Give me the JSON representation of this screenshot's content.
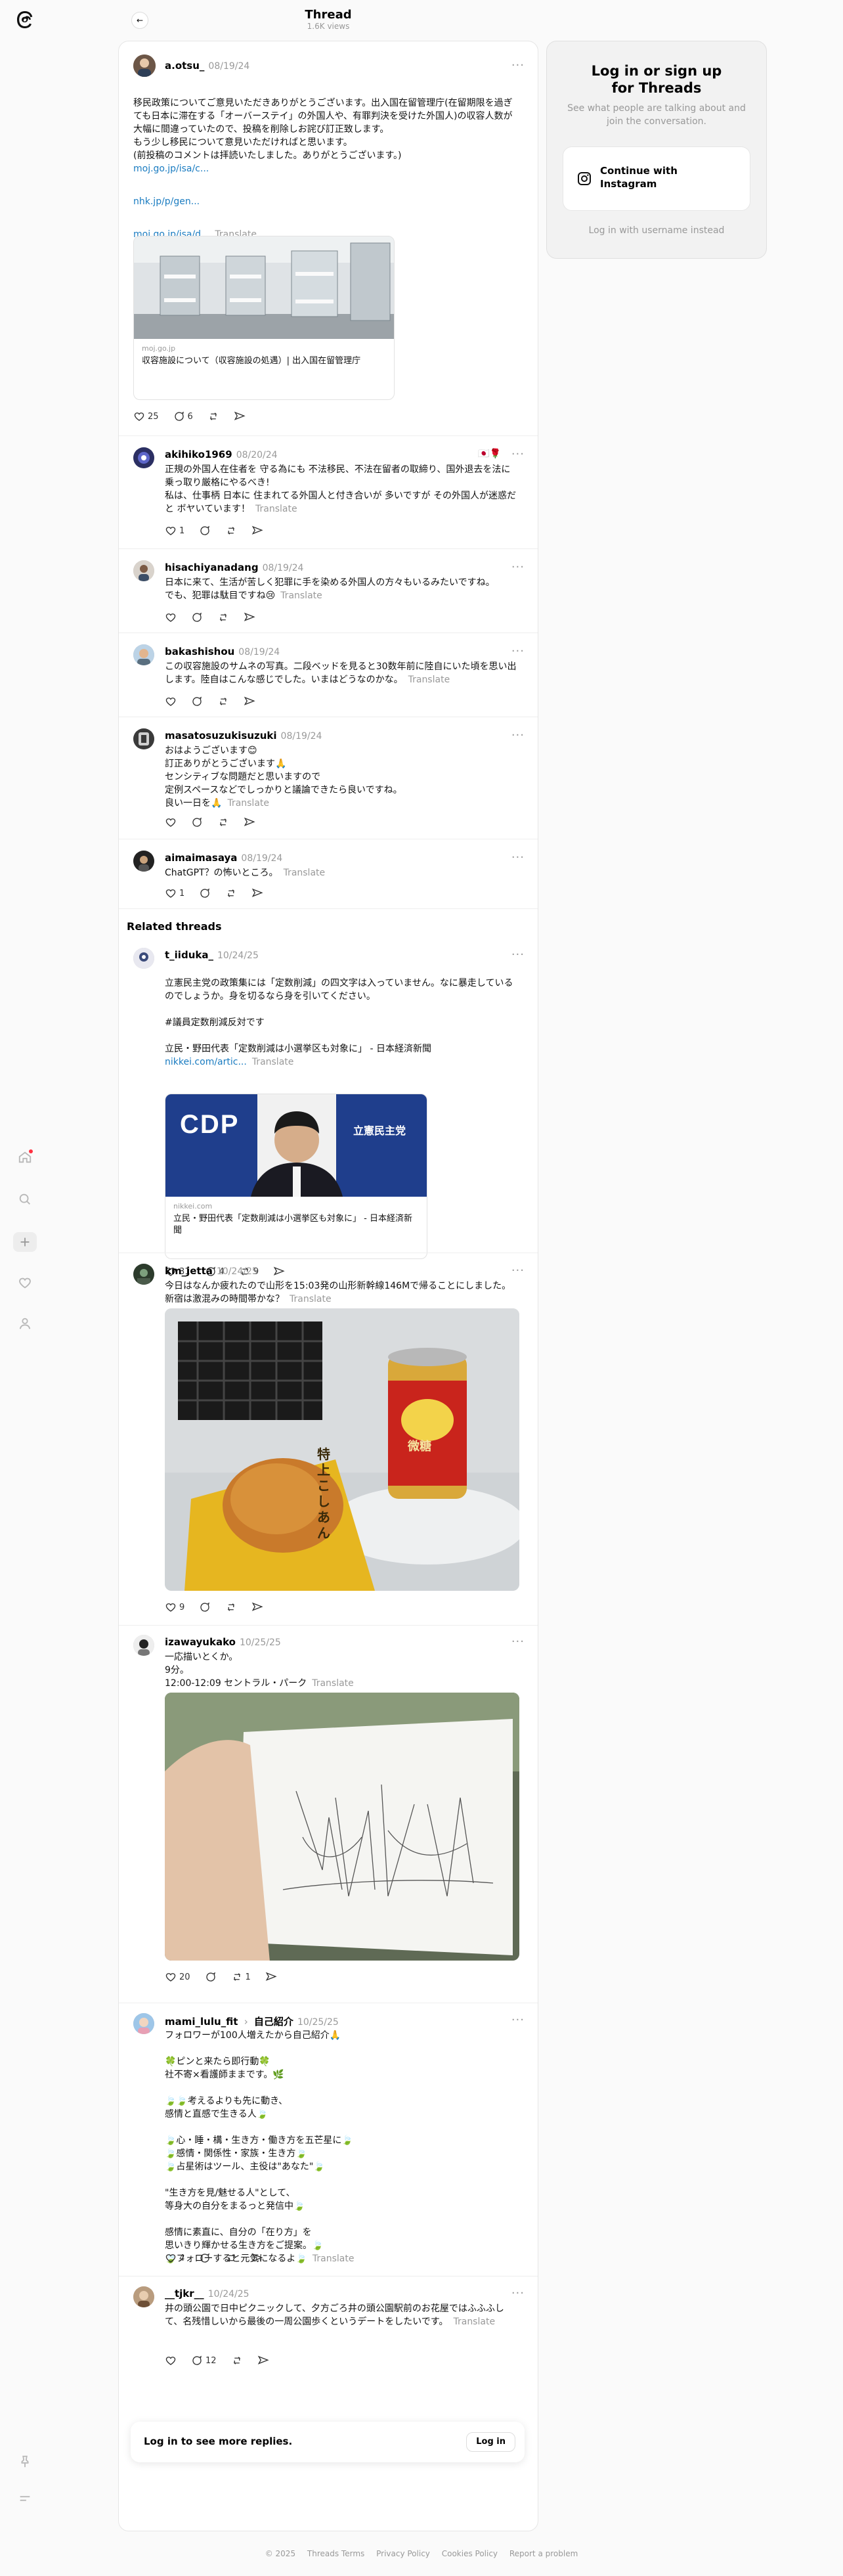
{
  "header": {
    "title": "Thread",
    "views": "1.6K views"
  },
  "sidebar": {
    "title": "Log in or sign up for Threads",
    "subtitle": "See what people are talking about and join the conversation.",
    "instagram_button": "Continue with Instagram",
    "alt_login": "Log in with username instead"
  },
  "translate": "Translate",
  "more": "···",
  "main_post": {
    "username": "a.otsu_",
    "date": "08/19/24",
    "text": "移民政策についてご意見いただきありがとうございます。出入国在留管理庁(在留期限を過ぎても日本に滞在する「オーバーステイ」の外国人や、有罪判決を受けた外国人)の収容人数が大幅に間違っていたので、投稿を削除しお詫び訂正致します。\nもう少し移民について意見いただければと思います。\n(前投稿のコメントは拝読いたしました。ありがとうございます。)",
    "links": [
      "moj.go.jp/isa/c...",
      "nhk.jp/p/gen...",
      "moj.go.jp/isa/d..."
    ],
    "card_domain": "moj.go.jp",
    "card_title": "収容施設について（収容施設の処遇）| 出入国在留管理庁",
    "likes": "25",
    "replies": "6"
  },
  "replies": [
    {
      "username": "akihiko1969",
      "date": "08/20/24",
      "text": "正規の外国人在住者を 守る為にも 不法移民、不法在留者の取締り、国外退去を法に乗っ取り厳格にやるべき!\n私は、仕事柄 日本に 住まれてる外国人と付き合いが 多いですが その外国人が迷惑だと ボヤいています！",
      "likes": "1",
      "replies": ""
    },
    {
      "username": "hisachiyanadang",
      "date": "08/19/24",
      "text": "日本に来て、生活が苦しく犯罪に手を染める外国人の方々もいるみたいですね。\nでも、犯罪は駄目ですね😢",
      "likes": "",
      "replies": ""
    },
    {
      "username": "bakashishou",
      "date": "08/19/24",
      "text": "この収容施設のサムネの写真。二段ベッドを見ると30数年前に陸自にいた頃を思い出します。陸自はこんな感じでした。いまはどうなのかな。",
      "likes": "",
      "replies": ""
    },
    {
      "username": "masatosuzukisuzuki",
      "date": "08/19/24",
      "text": "おはようございます😊\n訂正ありがとうございます🙏\nセンシティブな問題だと思いますので\n定例スペースなどでしっかりと議論できたら良いですね。\n良い一日を🙏",
      "likes": "",
      "replies": ""
    },
    {
      "username": "aimaimasaya",
      "date": "08/19/24",
      "text": "ChatGPT？の怖いところ。",
      "likes": "1",
      "replies": ""
    }
  ],
  "related_title": "Related threads",
  "related": [
    {
      "username": "t_iiduka_",
      "date": "10/24/25",
      "text": "立憲民主党の政策集には「定数削減」の四文字は入っていません。なに暴走しているのでしょうか。身を切るなら身を引いてください。\n\n#議員定数削減反対です\n\n立民・野田代表「定数削減は小選挙区も対象に」 - 日本経済新聞",
      "link": "nikkei.com/artic...",
      "card_domain": "nikkei.com",
      "card_title": "立民・野田代表「定数削減は小選挙区も対象に」 - 日本経済新聞",
      "logo_text": "CDP",
      "banner_text": "立憲民主党",
      "likes": "31",
      "replies": "4",
      "reposts": "9"
    },
    {
      "username": "km_jetta",
      "date": "10/24/25",
      "text": "今日はなんか疲れたので山形を15:03発の山形新幹線146Mで帰ることにしました。新宿は激混みの時間帯かな？",
      "image_labels": [
        "特上 こしあん",
        "微糖"
      ],
      "likes": "9",
      "replies": "",
      "reposts": ""
    },
    {
      "username": "izawayukako",
      "date": "10/25/25",
      "text": "一応描いとくか。\n9分。\n12:00-12:09 セントラル・パーク",
      "likes": "20",
      "replies": "",
      "reposts": "1"
    },
    {
      "username": "mami_lulu_fit",
      "tag": "自己紹介",
      "date": "10/25/25",
      "text": "フォロワーが100人増えたから自己紹介🙏\n\n🍀ピンと来たら即行動🍀\n社不寄×看護師ままです。🌿\n\n🍃🍃考えるよりも先に動き、\n感情と直感で生きる人🍃\n\n🍃心・睡・構・生き方・働き方を五芒星に🍃\n🍃感情・関係性・家族・生き方🍃\n🍃占星術はツール、主役は\"あなた\"🍃\n\n\"生き方を見/魅せる人\"として、\n等身大の自分をまるっと発信中🍃\n\n感情に素直に、自分の「在り方」を\n思いきり輝かせる生き方をご提案。🍃\n🍃フォローすると元気になるよ🍃",
      "likes": "4",
      "replies": "",
      "reposts": ""
    },
    {
      "username": "__tjkr__",
      "date": "10/24/25",
      "text": "井の頭公園で日中ピクニックして、夕方ごろ井の頭公園駅前のお花屋ではふふふして、名残惜しいから最後の一周公園歩くというデートをしたいです。",
      "likes": "",
      "replies": "12",
      "reposts": ""
    }
  ],
  "login_bar": {
    "text": "Log in to see more replies.",
    "button": "Log in"
  },
  "footer": [
    "© 2025",
    "Threads Terms",
    "Privacy Policy",
    "Cookies Policy",
    "Report a problem"
  ]
}
